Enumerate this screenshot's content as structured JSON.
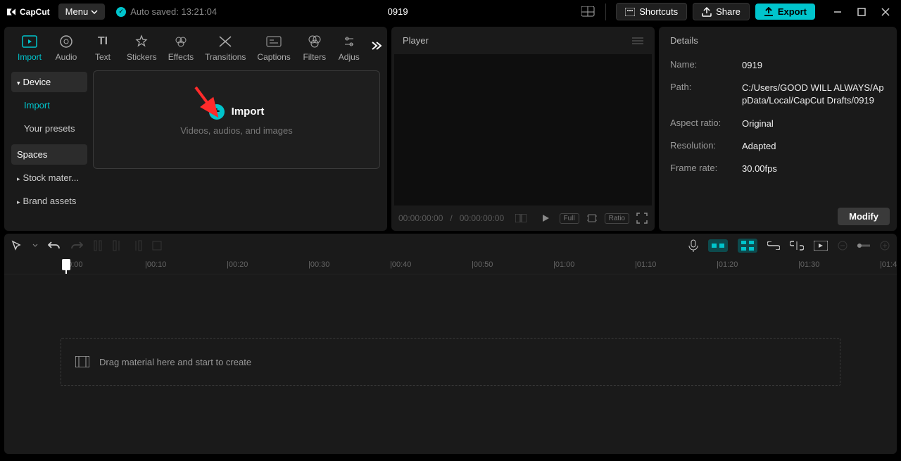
{
  "app": {
    "name": "CapCut"
  },
  "titlebar": {
    "menu_label": "Menu",
    "autosave_label": "Auto saved: 13:21:04",
    "project_title": "0919",
    "shortcuts_label": "Shortcuts",
    "share_label": "Share",
    "export_label": "Export"
  },
  "media_tabs": [
    {
      "key": "import",
      "label": "Import"
    },
    {
      "key": "audio",
      "label": "Audio"
    },
    {
      "key": "text",
      "label": "Text"
    },
    {
      "key": "stickers",
      "label": "Stickers"
    },
    {
      "key": "effects",
      "label": "Effects"
    },
    {
      "key": "transitions",
      "label": "Transitions"
    },
    {
      "key": "captions",
      "label": "Captions"
    },
    {
      "key": "filters",
      "label": "Filters"
    },
    {
      "key": "adjust",
      "label": "Adjus"
    }
  ],
  "media_sidebar": {
    "device": "Device",
    "import": "Import",
    "presets": "Your presets",
    "spaces": "Spaces",
    "stock": "Stock mater...",
    "brand": "Brand assets"
  },
  "import_zone": {
    "title": "Import",
    "subtitle": "Videos, audios, and images"
  },
  "player": {
    "title": "Player",
    "time_current": "00:00:00:00",
    "time_total": "00:00:00:00",
    "full_label": "Full",
    "ratio_label": "Ratio"
  },
  "details": {
    "title": "Details",
    "name_label": "Name:",
    "name_value": "0919",
    "path_label": "Path:",
    "path_value": "C:/Users/GOOD WILL ALWAYS/AppData/Local/CapCut Drafts/0919",
    "aspect_label": "Aspect ratio:",
    "aspect_value": "Original",
    "resolution_label": "Resolution:",
    "resolution_value": "Adapted",
    "framerate_label": "Frame rate:",
    "framerate_value": "30.00fps",
    "modify_label": "Modify"
  },
  "ruler_ticks": [
    "00:00",
    "|00:10",
    "|00:20",
    "|00:30",
    "|00:40",
    "|00:50",
    "|01:00",
    "|01:10",
    "|01:20",
    "|01:30",
    "|01:4"
  ],
  "timeline": {
    "drop_hint": "Drag material here and start to create"
  }
}
